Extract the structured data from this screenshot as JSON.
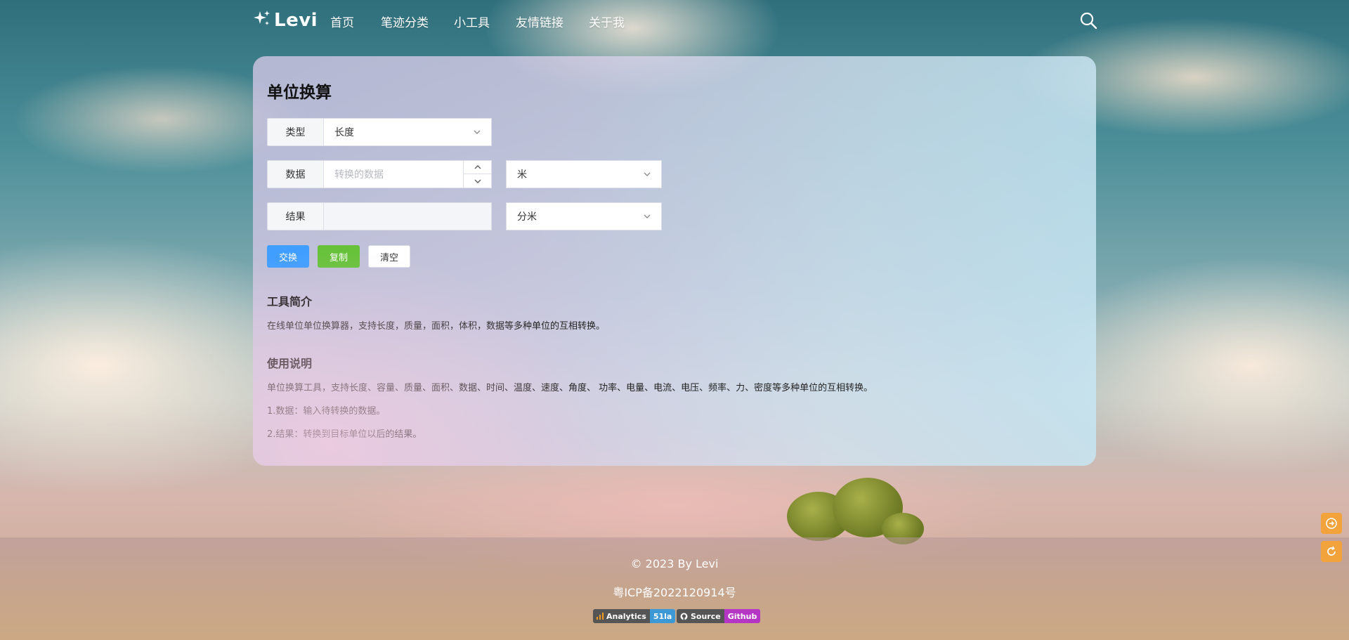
{
  "header": {
    "logo_text": "Levi",
    "nav": [
      {
        "label": "首页"
      },
      {
        "label": "笔迹分类"
      },
      {
        "label": "小工具"
      },
      {
        "label": "友情链接"
      },
      {
        "label": "关于我"
      }
    ]
  },
  "tool": {
    "title": "单位换算",
    "type_label": "类型",
    "type_value": "长度",
    "data_label": "数据",
    "data_placeholder": "转换的数据",
    "from_unit": "米",
    "result_label": "结果",
    "result_value": "",
    "to_unit": "分米",
    "buttons": {
      "swap": "交换",
      "copy": "复制",
      "clear": "清空"
    }
  },
  "intro": {
    "title": "工具简介",
    "text": "在线单位单位换算器，支持长度，质量，面积，体积，数据等多种单位的互相转换。"
  },
  "usage": {
    "title": "使用说明",
    "lines": [
      "单位换算工具，支持长度、容量、质量、面积、数据、时间、温度、速度、角度、 功率、电量、电流、电压、频率、力、密度等多种单位的互相转换。",
      "1.数据：输入待转换的数据。",
      "2.结果：转换到目标单位以后的结果。"
    ]
  },
  "footer": {
    "copyright": "© 2023 By Levi",
    "icp": "粤ICP备2022120914号",
    "badges": [
      {
        "left": "Analytics",
        "right": "51la",
        "color": "#3c99d6"
      },
      {
        "left": "Source",
        "right": "Github",
        "color": "#b536c4"
      }
    ]
  },
  "icons": {
    "logo": "sparkle-icon",
    "search": "search-icon",
    "chevron": "chevron-down-icon",
    "side_top": "arrow-right-circle-icon",
    "side_bottom": "refresh-icon"
  },
  "colors": {
    "primary": "#409eff",
    "success": "#67c23a",
    "side_button": "#f2a33c"
  }
}
